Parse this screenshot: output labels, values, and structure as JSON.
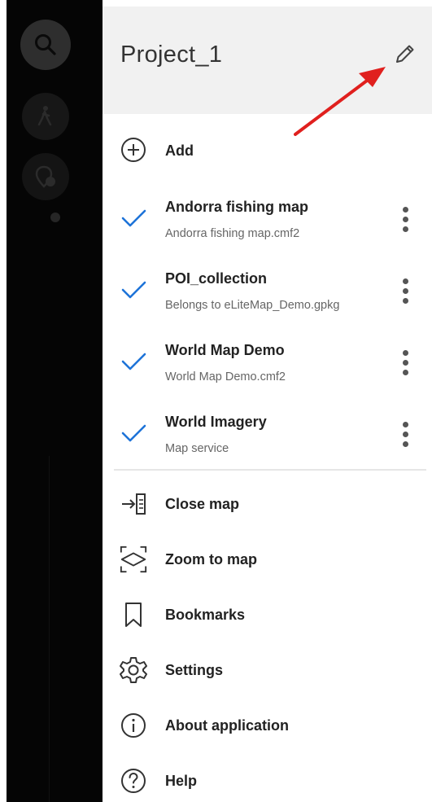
{
  "colors": {
    "accent": "#1e73d8",
    "annotation": "#e0201e",
    "header_bg": "#f1f1f1",
    "map_bg": "#050505"
  },
  "header": {
    "title": "Project_1",
    "edit_icon": "pencil-icon"
  },
  "add_action": {
    "label": "Add",
    "icon": "plus-circle-icon"
  },
  "layers": [
    {
      "title": "Andorra fishing map",
      "subtitle": "Andorra fishing map.cmf2",
      "checked": true
    },
    {
      "title": "POI_collection",
      "subtitle": "Belongs to eLiteMap_Demo.gpkg",
      "checked": true
    },
    {
      "title": "World Map Demo",
      "subtitle": "World Map Demo.cmf2",
      "checked": true
    },
    {
      "title": "World Imagery",
      "subtitle": "Map service",
      "checked": true
    }
  ],
  "menu": [
    {
      "label": "Close map",
      "icon": "close-map-icon"
    },
    {
      "label": "Zoom to map",
      "icon": "zoom-to-map-icon"
    },
    {
      "label": "Bookmarks",
      "icon": "bookmark-icon"
    },
    {
      "label": "Settings",
      "icon": "gear-icon"
    },
    {
      "label": "About application",
      "icon": "info-icon"
    },
    {
      "label": "Help",
      "icon": "help-icon"
    }
  ],
  "map_controls": [
    "search-icon",
    "walk-route-icon",
    "add-poi-icon"
  ]
}
